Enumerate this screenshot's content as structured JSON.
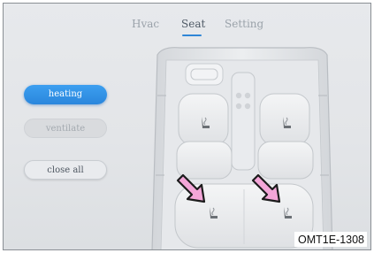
{
  "tabs": [
    {
      "label": "Hvac",
      "active": false
    },
    {
      "label": "Seat",
      "active": true
    },
    {
      "label": "Setting",
      "active": false
    }
  ],
  "buttons": {
    "heating": "heating",
    "ventilate": "ventilate",
    "close_all": "close all"
  },
  "seats": [
    {
      "position": "front-left",
      "icon": "seat-heater-icon"
    },
    {
      "position": "front-right",
      "icon": "seat-heater-icon"
    },
    {
      "position": "rear-left",
      "icon": "seat-heater-icon"
    },
    {
      "position": "rear-right",
      "icon": "seat-heater-icon"
    }
  ],
  "colors": {
    "accent": "#2f86d6",
    "arrow_fill": "#f3a6d8",
    "background": "#e5e7ea"
  },
  "caption": "OMT1E-1308"
}
